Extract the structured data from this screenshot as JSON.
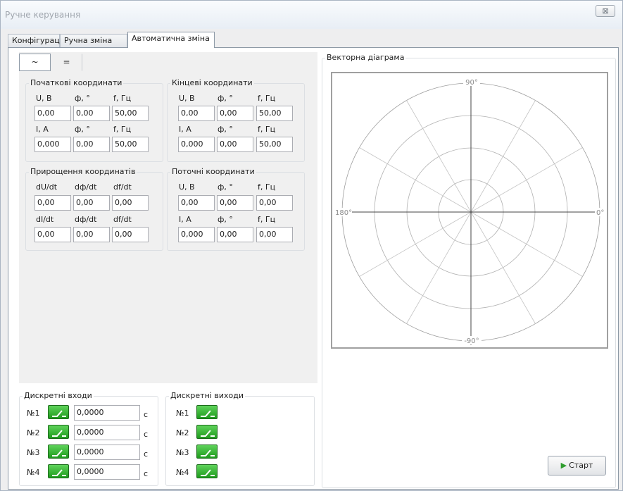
{
  "window": {
    "title": "Ручне керування",
    "close_glyph": "⊠"
  },
  "tabs": [
    "Конфігурація",
    "Ручна зміна",
    "Автоматична зміна"
  ],
  "mode_tabs": [
    "~",
    "="
  ],
  "groups": {
    "initial": {
      "title": "Початкові координати",
      "u_label": "U, В",
      "phi_label": "ф, °",
      "f_label": "f, Гц",
      "u": "0,00",
      "u_phi": "0,00",
      "u_f": "50,00",
      "i_label": "I, A",
      "phi2_label": "ф, °",
      "f2_label": "f, Гц",
      "i": "0,000",
      "i_phi": "0,00",
      "i_f": "50,00"
    },
    "final": {
      "title": "Кінцеві координати",
      "u_label": "U, В",
      "phi_label": "ф, °",
      "f_label": "f, Гц",
      "u": "0,00",
      "u_phi": "0,00",
      "u_f": "50,00",
      "i_label": "I, A",
      "phi2_label": "ф, °",
      "f2_label": "f, Гц",
      "i": "0,000",
      "i_phi": "0,00",
      "i_f": "50,00"
    },
    "increment": {
      "title": "Прирощення координатів",
      "u_label": "dU/dt",
      "phi_label": "dф/dt",
      "f_label": "df/dt",
      "u": "0,00",
      "u_phi": "0,00",
      "u_f": "0,00",
      "i_label": "dI/dt",
      "phi2_label": "dф/dt",
      "f2_label": "df/dt",
      "i": "0,00",
      "i_phi": "0,00",
      "i_f": "0,00"
    },
    "current": {
      "title": "Поточні координати",
      "u_label": "U, В",
      "phi_label": "ф, °",
      "f_label": "f, Гц",
      "u": "0,00",
      "u_phi": "0,00",
      "u_f": "0,00",
      "i_label": "I, A",
      "phi2_label": "ф, °",
      "f2_label": "f, Гц",
      "i": "0,000",
      "i_phi": "0,00",
      "i_f": "0,00"
    }
  },
  "vector": {
    "title": "Векторна діаграма",
    "label_top": "90°",
    "label_bottom": "-90°",
    "label_left": "180°",
    "label_right": "0°"
  },
  "discrete_inputs": {
    "title": "Дискретні входи",
    "unit": "с",
    "rows": [
      {
        "label": "№1",
        "value": "0,0000"
      },
      {
        "label": "№2",
        "value": "0,0000"
      },
      {
        "label": "№3",
        "value": "0,0000"
      },
      {
        "label": "№4",
        "value": "0,0000"
      }
    ]
  },
  "discrete_outputs": {
    "title": "Дискретні виходи",
    "rows": [
      {
        "label": "№1"
      },
      {
        "label": "№2"
      },
      {
        "label": "№3"
      },
      {
        "label": "№4"
      }
    ]
  },
  "start_button": "Старт",
  "colors": {
    "switch_green": "#2fb52c",
    "start_icon": "#2f9d2f"
  }
}
